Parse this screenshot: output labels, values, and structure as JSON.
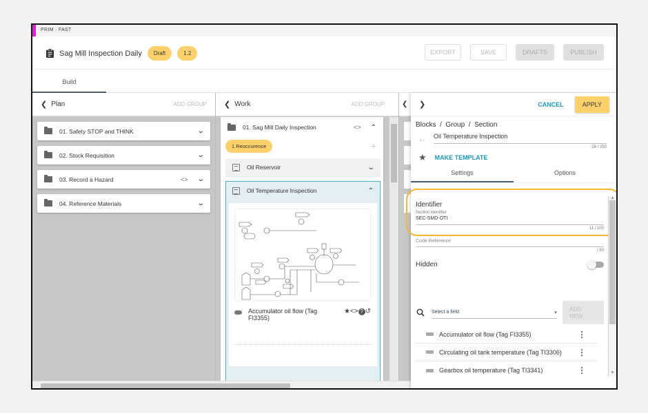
{
  "app": {
    "env_label": "PRIM · FAST"
  },
  "header": {
    "title": "Sag Mill Inspection Daily",
    "status_badge": "Draft",
    "version_badge": "1.2",
    "buttons": {
      "export": "EXPORT",
      "save": "SAVE",
      "drafts": "DRAFTS",
      "publish": "PUBLISH"
    }
  },
  "tabs": [
    {
      "label": "Build",
      "active": true
    }
  ],
  "plan": {
    "title": "Plan",
    "add_group": "ADD GROUP",
    "groups": [
      {
        "label": "01. Safety STOP and THINK"
      },
      {
        "label": "02. Stock Requisition"
      },
      {
        "label": "03. Record a Hazard",
        "has_code": true
      },
      {
        "label": "04. Reference Materials"
      }
    ]
  },
  "work": {
    "title": "Work",
    "add_group": "ADD GROUP",
    "group": {
      "label": "01. Sag Mill Daily Inspection",
      "badge": "1 Reoccurence",
      "sections": [
        {
          "label": "Oil Reservoir",
          "expanded": false
        },
        {
          "label": "Oil Temperature Inspection",
          "expanded": true
        }
      ],
      "field": {
        "label_line1": "Accumulator oil flow (Tag",
        "label_line2": "FI3355)"
      }
    }
  },
  "panel": {
    "cancel": "CANCEL",
    "apply": "APPLY",
    "breadcrumb": [
      "Blocks",
      "Group",
      "Section"
    ],
    "name_value": "Oil Temperature Inspection",
    "name_counter": "26 / 250",
    "make_template": "MAKE TEMPLATE",
    "tabs": [
      "Settings",
      "Options"
    ],
    "identifier_heading": "Identifier",
    "identifier_label": "Section Identifier",
    "identifier_value": "SEC-SMD-OTI",
    "identifier_counter": "11 / 100",
    "code_ref_label": "Code Reference",
    "code_ref_counter": "/ 50",
    "hidden_label": "Hidden",
    "hidden_on": false,
    "select_placeholder": "Select a field",
    "add_new": "ADD NEW",
    "fields": [
      "Accumulator oil flow (Tag FI3355)",
      "Circulating oil tank temperature (Tag TI3306)",
      "Gearbox oil temperature (Tag TI3341)"
    ]
  },
  "colors": {
    "accent": "#fcd06b",
    "link": "#1a9bc0",
    "highlight": "#f5b731",
    "env": "#e01ee0"
  }
}
